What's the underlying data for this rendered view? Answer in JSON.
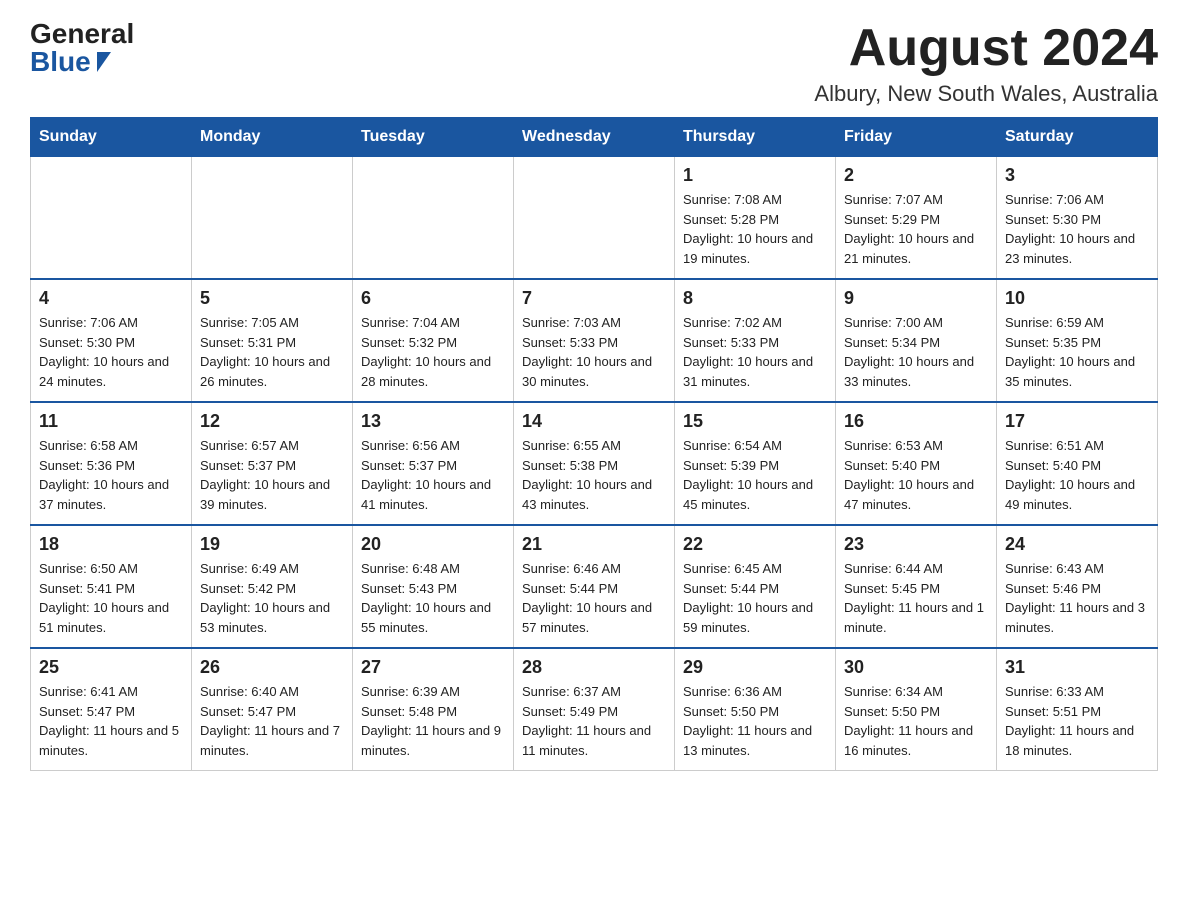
{
  "header": {
    "logo_general": "General",
    "logo_blue": "Blue",
    "month_title": "August 2024",
    "location": "Albury, New South Wales, Australia"
  },
  "weekdays": [
    "Sunday",
    "Monday",
    "Tuesday",
    "Wednesday",
    "Thursday",
    "Friday",
    "Saturday"
  ],
  "weeks": [
    [
      {
        "day": "",
        "info": ""
      },
      {
        "day": "",
        "info": ""
      },
      {
        "day": "",
        "info": ""
      },
      {
        "day": "",
        "info": ""
      },
      {
        "day": "1",
        "info": "Sunrise: 7:08 AM\nSunset: 5:28 PM\nDaylight: 10 hours and 19 minutes."
      },
      {
        "day": "2",
        "info": "Sunrise: 7:07 AM\nSunset: 5:29 PM\nDaylight: 10 hours and 21 minutes."
      },
      {
        "day": "3",
        "info": "Sunrise: 7:06 AM\nSunset: 5:30 PM\nDaylight: 10 hours and 23 minutes."
      }
    ],
    [
      {
        "day": "4",
        "info": "Sunrise: 7:06 AM\nSunset: 5:30 PM\nDaylight: 10 hours and 24 minutes."
      },
      {
        "day": "5",
        "info": "Sunrise: 7:05 AM\nSunset: 5:31 PM\nDaylight: 10 hours and 26 minutes."
      },
      {
        "day": "6",
        "info": "Sunrise: 7:04 AM\nSunset: 5:32 PM\nDaylight: 10 hours and 28 minutes."
      },
      {
        "day": "7",
        "info": "Sunrise: 7:03 AM\nSunset: 5:33 PM\nDaylight: 10 hours and 30 minutes."
      },
      {
        "day": "8",
        "info": "Sunrise: 7:02 AM\nSunset: 5:33 PM\nDaylight: 10 hours and 31 minutes."
      },
      {
        "day": "9",
        "info": "Sunrise: 7:00 AM\nSunset: 5:34 PM\nDaylight: 10 hours and 33 minutes."
      },
      {
        "day": "10",
        "info": "Sunrise: 6:59 AM\nSunset: 5:35 PM\nDaylight: 10 hours and 35 minutes."
      }
    ],
    [
      {
        "day": "11",
        "info": "Sunrise: 6:58 AM\nSunset: 5:36 PM\nDaylight: 10 hours and 37 minutes."
      },
      {
        "day": "12",
        "info": "Sunrise: 6:57 AM\nSunset: 5:37 PM\nDaylight: 10 hours and 39 minutes."
      },
      {
        "day": "13",
        "info": "Sunrise: 6:56 AM\nSunset: 5:37 PM\nDaylight: 10 hours and 41 minutes."
      },
      {
        "day": "14",
        "info": "Sunrise: 6:55 AM\nSunset: 5:38 PM\nDaylight: 10 hours and 43 minutes."
      },
      {
        "day": "15",
        "info": "Sunrise: 6:54 AM\nSunset: 5:39 PM\nDaylight: 10 hours and 45 minutes."
      },
      {
        "day": "16",
        "info": "Sunrise: 6:53 AM\nSunset: 5:40 PM\nDaylight: 10 hours and 47 minutes."
      },
      {
        "day": "17",
        "info": "Sunrise: 6:51 AM\nSunset: 5:40 PM\nDaylight: 10 hours and 49 minutes."
      }
    ],
    [
      {
        "day": "18",
        "info": "Sunrise: 6:50 AM\nSunset: 5:41 PM\nDaylight: 10 hours and 51 minutes."
      },
      {
        "day": "19",
        "info": "Sunrise: 6:49 AM\nSunset: 5:42 PM\nDaylight: 10 hours and 53 minutes."
      },
      {
        "day": "20",
        "info": "Sunrise: 6:48 AM\nSunset: 5:43 PM\nDaylight: 10 hours and 55 minutes."
      },
      {
        "day": "21",
        "info": "Sunrise: 6:46 AM\nSunset: 5:44 PM\nDaylight: 10 hours and 57 minutes."
      },
      {
        "day": "22",
        "info": "Sunrise: 6:45 AM\nSunset: 5:44 PM\nDaylight: 10 hours and 59 minutes."
      },
      {
        "day": "23",
        "info": "Sunrise: 6:44 AM\nSunset: 5:45 PM\nDaylight: 11 hours and 1 minute."
      },
      {
        "day": "24",
        "info": "Sunrise: 6:43 AM\nSunset: 5:46 PM\nDaylight: 11 hours and 3 minutes."
      }
    ],
    [
      {
        "day": "25",
        "info": "Sunrise: 6:41 AM\nSunset: 5:47 PM\nDaylight: 11 hours and 5 minutes."
      },
      {
        "day": "26",
        "info": "Sunrise: 6:40 AM\nSunset: 5:47 PM\nDaylight: 11 hours and 7 minutes."
      },
      {
        "day": "27",
        "info": "Sunrise: 6:39 AM\nSunset: 5:48 PM\nDaylight: 11 hours and 9 minutes."
      },
      {
        "day": "28",
        "info": "Sunrise: 6:37 AM\nSunset: 5:49 PM\nDaylight: 11 hours and 11 minutes."
      },
      {
        "day": "29",
        "info": "Sunrise: 6:36 AM\nSunset: 5:50 PM\nDaylight: 11 hours and 13 minutes."
      },
      {
        "day": "30",
        "info": "Sunrise: 6:34 AM\nSunset: 5:50 PM\nDaylight: 11 hours and 16 minutes."
      },
      {
        "day": "31",
        "info": "Sunrise: 6:33 AM\nSunset: 5:51 PM\nDaylight: 11 hours and 18 minutes."
      }
    ]
  ]
}
